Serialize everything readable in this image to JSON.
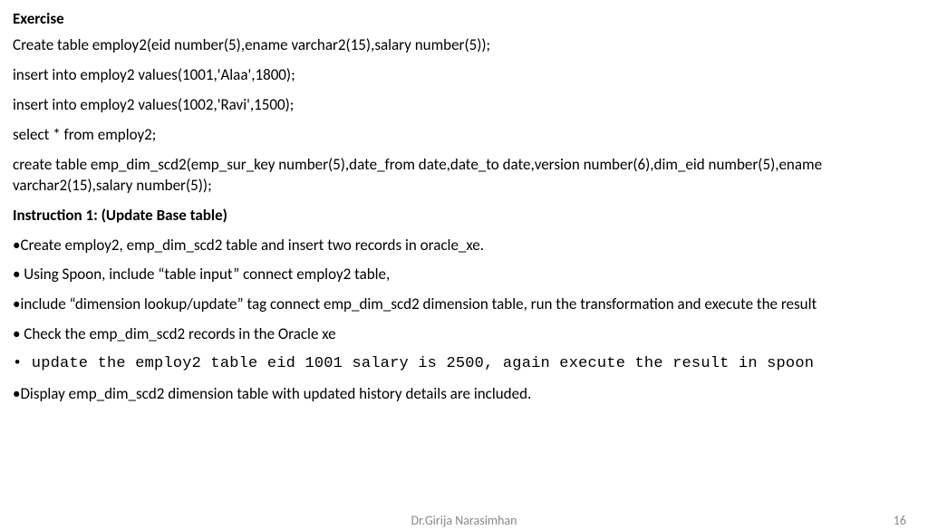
{
  "title": "Exercise",
  "code": {
    "l1": "Create table employ2(eid number(5),ename  varchar2(15),salary number(5));",
    "l2": "insert into employ2 values(1001,'Alaa',1800);",
    "l3": " insert into employ2 values(1002,'Ravi',1500);",
    "l4": "select * from employ2;",
    "l5": "create table emp_dim_scd2(emp_sur_key number(5),date_from date,date_to date,version  number(6),dim_eid number(5),ename  varchar2(15),salary number(5));"
  },
  "instr_heading": "Instruction 1: (Update Base table)",
  "bullets": {
    "b1": "•Create  employ2, emp_dim_scd2 table and insert two records in  oracle_xe.",
    "b2": "• Using Spoon, include “table input” connect employ2 table,",
    "b3": "•include “dimension lookup/update”  tag connect emp_dim_scd2  dimension  table, run the transformation and execute the result",
    "b4": "• Check the emp_dim_scd2 records in the Oracle xe",
    "b5": "• update  the employ2 table eid 1001 salary is 2500, again execute the result in spoon",
    "b6": "•Display  emp_dim_scd2 dimension table with updated history details are included."
  },
  "footer": {
    "author": "Dr.Girija Narasimhan",
    "page": "16"
  }
}
